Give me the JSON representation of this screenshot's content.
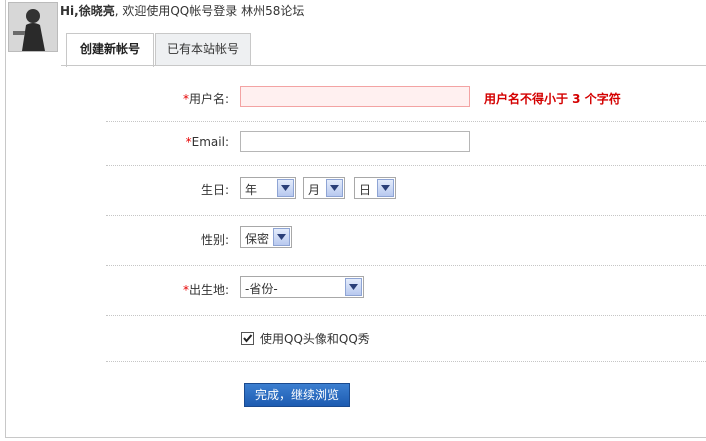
{
  "header": {
    "greeting_prefix": "Hi,",
    "username": "徐晓亮",
    "welcome": ", 欢迎使用QQ帐号登录 林州58论坛"
  },
  "tabs": [
    {
      "label": "创建新帐号",
      "active": true
    },
    {
      "label": "已有本站帐号",
      "active": false
    }
  ],
  "form": {
    "required_mark": "*",
    "username": {
      "label": "用户名:",
      "value": "",
      "error": "用户名不得小于 3 个字符"
    },
    "email": {
      "label": "Email:",
      "value": ""
    },
    "birthday": {
      "label": "生日:",
      "year": "年",
      "month": "月",
      "day": "日"
    },
    "gender": {
      "label": "性别:",
      "selected": "保密"
    },
    "birthplace": {
      "label": "出生地:",
      "selected": "-省份-"
    },
    "use_qq_avatar": {
      "label": "使用QQ头像和QQ秀",
      "checked": true
    },
    "submit_label": "完成，继续浏览"
  },
  "colors": {
    "required": "#e60000",
    "error": "#d40000",
    "button": "#2a6cc4"
  }
}
